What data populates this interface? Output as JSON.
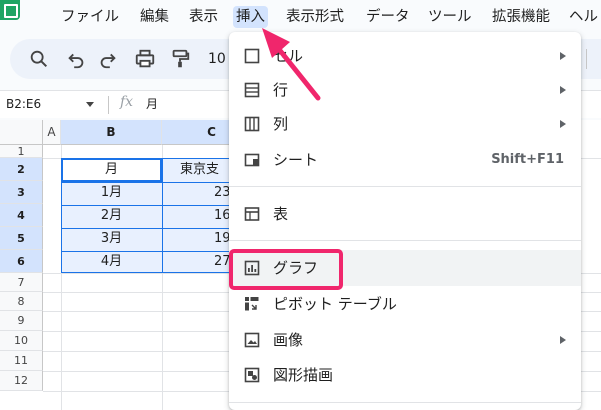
{
  "menubar": {
    "items": [
      "ファイル",
      "編集",
      "表示",
      "挿入",
      "表示形式",
      "データ",
      "ツール",
      "拡張機能",
      "ヘル"
    ]
  },
  "toolbar": {
    "zoom_partial": "10",
    "icons": [
      "search-icon",
      "undo-icon",
      "redo-icon",
      "print-icon",
      "paint-format-icon"
    ]
  },
  "formula_bar": {
    "name_box": "B2:E6",
    "fx": "fx",
    "content": "月"
  },
  "grid": {
    "columns": [
      "A",
      "B",
      "C"
    ],
    "rows": [
      "1",
      "2",
      "3",
      "4",
      "5",
      "6",
      "7",
      "8",
      "9",
      "10",
      "11",
      "12"
    ],
    "col_b": [
      "月",
      "1月",
      "2月",
      "3月",
      "4月"
    ],
    "col_c": [
      "東京支",
      "23",
      "16",
      "19",
      "27"
    ]
  },
  "dropdown": {
    "items": [
      {
        "label": "セル",
        "icon": "cell-icon",
        "submenu": true
      },
      {
        "label": "行",
        "icon": "row-icon",
        "submenu": true
      },
      {
        "label": "列",
        "icon": "column-icon",
        "submenu": true
      },
      {
        "label": "シート",
        "icon": "sheet-icon",
        "shortcut": "Shift+F11"
      },
      {
        "label": "表",
        "icon": "table-icon"
      },
      {
        "label": "グラフ",
        "icon": "chart-icon"
      },
      {
        "label": "ピボット テーブル",
        "icon": "pivot-table-icon"
      },
      {
        "label": "画像",
        "icon": "image-icon",
        "submenu": true
      },
      {
        "label": "図形描画",
        "icon": "drawing-icon"
      }
    ]
  },
  "colors": {
    "accent": "#1a73e8",
    "annotation": "#f0266c",
    "selection_fill": "#e8f0fe",
    "header_selected": "#d3e3fd"
  }
}
